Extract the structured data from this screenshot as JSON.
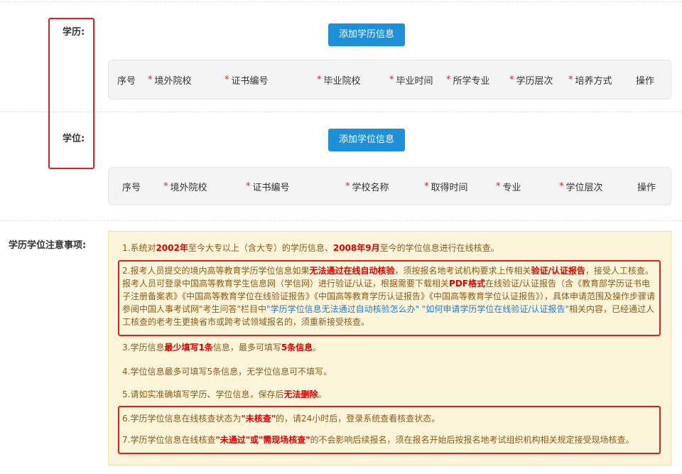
{
  "education": {
    "label": "学历:",
    "add_button": "添加学历信息",
    "columns": [
      {
        "label": "序号",
        "required": false
      },
      {
        "label": "境外院校",
        "required": true
      },
      {
        "label": "证书编号",
        "required": true
      },
      {
        "label": "毕业院校",
        "required": true
      },
      {
        "label": "毕业时间",
        "required": true
      },
      {
        "label": "所学专业",
        "required": true
      },
      {
        "label": "学历层次",
        "required": true
      },
      {
        "label": "培养方式",
        "required": true
      },
      {
        "label": "操作",
        "required": false
      }
    ]
  },
  "degree": {
    "label": "学位:",
    "add_button": "添加学位信息",
    "columns": [
      {
        "label": "序号",
        "required": false
      },
      {
        "label": "境外院校",
        "required": true
      },
      {
        "label": "证书编号",
        "required": true
      },
      {
        "label": "学校名称",
        "required": true
      },
      {
        "label": "取得时间",
        "required": true
      },
      {
        "label": "专业",
        "required": true
      },
      {
        "label": "学位层次",
        "required": true
      },
      {
        "label": "操作",
        "required": false
      }
    ]
  },
  "notes": {
    "label": "学历学位注意事项:",
    "n1": {
      "a": "1.系统对",
      "b": "2002年",
      "c": "至今大专以上（含大专）的学历信息、",
      "d": "2008年9月",
      "e": "至今的学位信息进行在线核查。"
    },
    "n2": {
      "a": "2.报考人员提交的境内高等教育学历学位信息如果",
      "b": "无法通过在线自动核验",
      "c": "，须按报名地考试机构要求上传相关",
      "d": "验证/认证报告",
      "e": "，接受人工核查。报考人员可登录中国高等教育学生信息网（学信网）进行验证/认证，根据需要下载相关",
      "f": "PDF格式",
      "g": "在线验证/认证报告（含《教育部学历证书电子注册备案表》《中国高等教育学位在线验证报告》《中国高等教育学历认证报告》《中国高等教育学位认证报告》），具体申请范围及操作步骤请参阅中国人事考试网\"考生问答\"栏目中",
      "h": "\"学历学位信息无法通过自动核验怎么办\" \"如何申请学历学位在线验证/认证报告\"",
      "i": "相关内容，已经通过人工核查的老考生更换省市或跨考试领域报名的，须重新接受核查。"
    },
    "n3": {
      "a": "3.学历信息",
      "b": "最少填写1条",
      "c": "信息，最多可填写",
      "d": "5条信息",
      "e": "。"
    },
    "n4": "4.学位信息最多可填写5条信息，无学位信息可不填写。",
    "n5": {
      "a": "5.请如实准确填写学历、学位信息，保存后",
      "b": "无法删除",
      "c": "。"
    },
    "n6": {
      "a": "6.学历学位信息在线核查状态为",
      "b": "\"未核查\"",
      "c": "的，请24小时后，登录系统查看核查状态。"
    },
    "n7": {
      "a": "7.学历学位信息在线核查",
      "b": "\"未通过\"或\"需现场核查\"",
      "c": "的不会影响后续报名，须在报名开始后按报名地考试组织机构相关规定接受现场核查。"
    }
  },
  "colors": {
    "accent": "#1e90d8",
    "highlight": "#e02020",
    "notice_bg": "#fdf5d9"
  }
}
